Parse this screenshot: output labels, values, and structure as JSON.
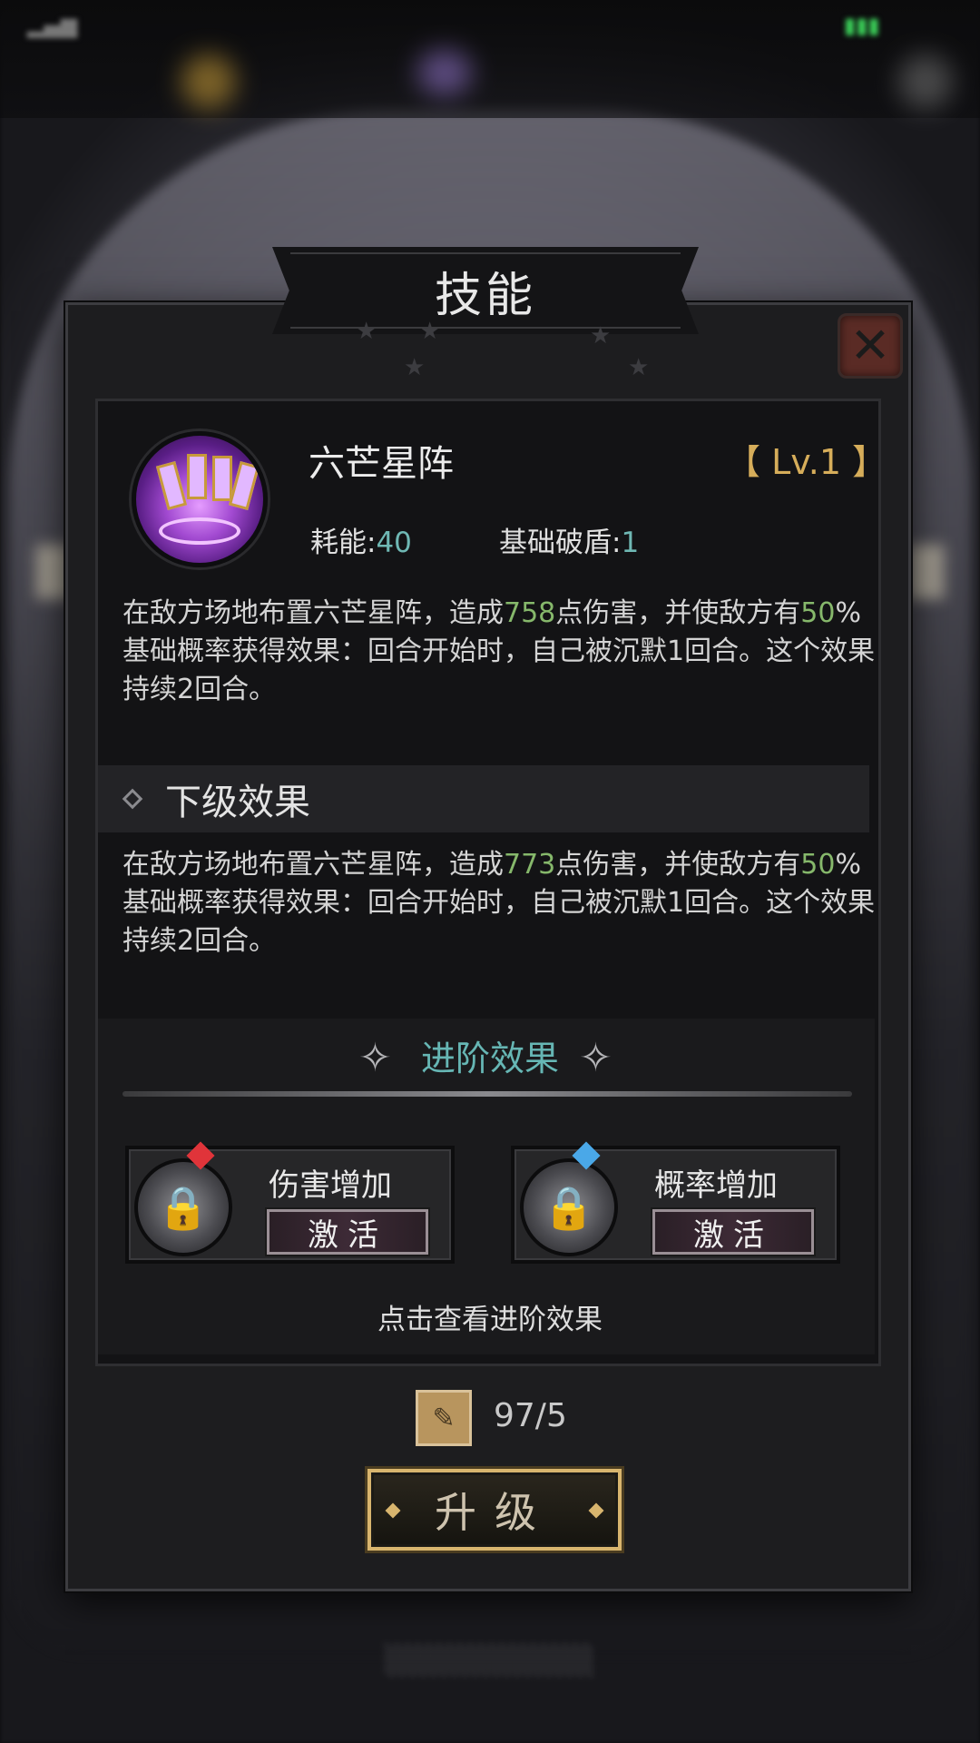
{
  "dialog": {
    "title": "技能",
    "close_icon": "close-x-icon"
  },
  "skill": {
    "name": "六芒星阵",
    "level": "【 Lv.1 】",
    "cost_label": "耗能:",
    "cost_value": "40",
    "break_label": "基础破盾:",
    "break_value": "1",
    "desc_p1": "在敌方场地布置六芒星阵，造成",
    "desc_damage": "758",
    "desc_p2": "点伤害，并使敌方有",
    "desc_chance": "50",
    "desc_p3": "%基础概率获得效果：回合开始时，自己被沉默1回合。这个效果持续2回合。"
  },
  "next_level": {
    "title": "下级效果",
    "desc_p1": "在敌方场地布置六芒星阵，造成",
    "desc_damage": "773",
    "desc_p2": "点伤害，并使敌方有",
    "desc_chance": "50",
    "desc_p3": "%基础概率获得效果：回合开始时，自己被沉默1回合。这个效果持续2回合。"
  },
  "advanced": {
    "title": "进阶效果",
    "cards": [
      {
        "name": "伤害增加",
        "button": "激活",
        "gem_color": "#e0343a"
      },
      {
        "name": "概率增加",
        "button": "激活",
        "gem_color": "#4aa8e8"
      }
    ],
    "hint": "点击查看进阶效果"
  },
  "material": {
    "count": "97/5"
  },
  "upgrade_button": "升级",
  "colors": {
    "accent_teal": "#66b6b4",
    "number_green": "#86b86b",
    "gold": "#d6ad5a"
  }
}
